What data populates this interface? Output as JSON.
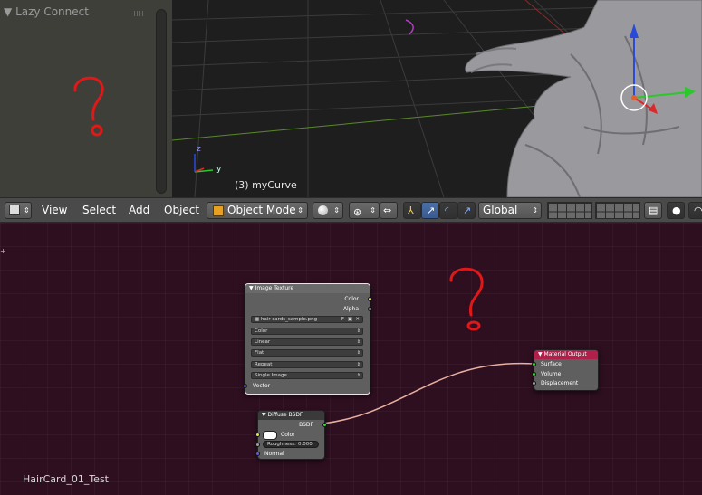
{
  "left_panel": {
    "title": "Lazy Connect"
  },
  "viewport": {
    "object_label": "(3) myCurve",
    "axis_y": "y",
    "axis_z": "z"
  },
  "toolbar": {
    "menu_view": "View",
    "menu_select": "Select",
    "menu_add": "Add",
    "menu_object": "Object",
    "mode": "Object Mode",
    "orientation": "Global"
  },
  "node_editor": {
    "scene_name": "HairCard_01_Test",
    "image_texture": {
      "title": "Image Texture",
      "out_color": "Color",
      "out_alpha": "Alpha",
      "image_name": "hair-cards_sample.png",
      "color_space": "Color",
      "interpolation": "Linear",
      "projection": "Flat",
      "extension": "Repeat",
      "source": "Single Image",
      "in_vector": "Vector"
    },
    "diffuse": {
      "title": "Diffuse BSDF",
      "out_bsdf": "BSDF",
      "in_color": "Color",
      "roughness_label": "Roughness:",
      "roughness_value": "0.000",
      "in_normal": "Normal"
    },
    "material_output": {
      "title": "Material Output",
      "surface": "Surface",
      "volume": "Volume",
      "displacement": "Displacement"
    }
  },
  "colors": {
    "accent_blue": "#4a6fa5",
    "node_editor_bg": "#2e0f20",
    "material_output_header": "#b0204a",
    "annotation_red": "#e01818"
  }
}
